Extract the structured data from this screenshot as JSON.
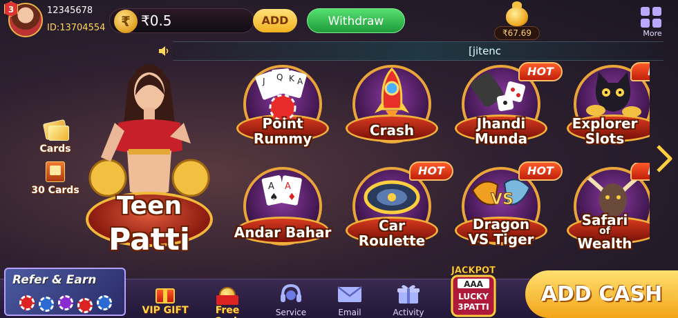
{
  "player": {
    "level": "3",
    "name": "12345678",
    "id": "ID:13704554"
  },
  "wallet": {
    "balance": "₹0.5",
    "add_label": "ADD",
    "withdraw_label": "Withdraw",
    "rupee_symbol": "₹"
  },
  "jackpot": {
    "amount": "₹67.69"
  },
  "more": {
    "label": "More"
  },
  "marquee": {
    "text": "[jitenc"
  },
  "side": {
    "cards_label": "Cards",
    "thirty_cards_label": "30 Cards"
  },
  "hero": {
    "line1": "Teen",
    "line2": "Patti"
  },
  "games": [
    {
      "line1": "Point",
      "line2": "Rummy",
      "hot": false
    },
    {
      "line1": "Crash",
      "line2": "",
      "hot": false
    },
    {
      "line1": "Jhandi",
      "line2": "Munda",
      "hot": true,
      "hot_label": "HOT"
    },
    {
      "line1": "Explorer",
      "line2": "Slots",
      "hot": true,
      "hot_label": "H"
    },
    {
      "line1": "Andar Bahar",
      "line2": "",
      "hot": false
    },
    {
      "line1": "Car",
      "line2": "Roulette",
      "hot": true,
      "hot_label": "HOT"
    },
    {
      "line1": "Dragon",
      "line2": "VS Tiger",
      "hot": true,
      "hot_label": "HOT",
      "vs": "VS"
    },
    {
      "line1": "Safari",
      "line_of": "of",
      "line2": "Wealth",
      "hot": true,
      "hot_label": "H"
    }
  ],
  "bottom": {
    "refer_label": "Refer & Earn",
    "vip_label": "VIP GIFT",
    "free_cash_label": "Free Cash",
    "service_label": "Service",
    "email_label": "Email",
    "activity_label": "Activity",
    "lucky": {
      "top": "JACKPOT",
      "aaa": "AAA",
      "line1": "LUCKY",
      "line2": "3PATTI"
    },
    "add_cash_label": "ADD CASH"
  }
}
